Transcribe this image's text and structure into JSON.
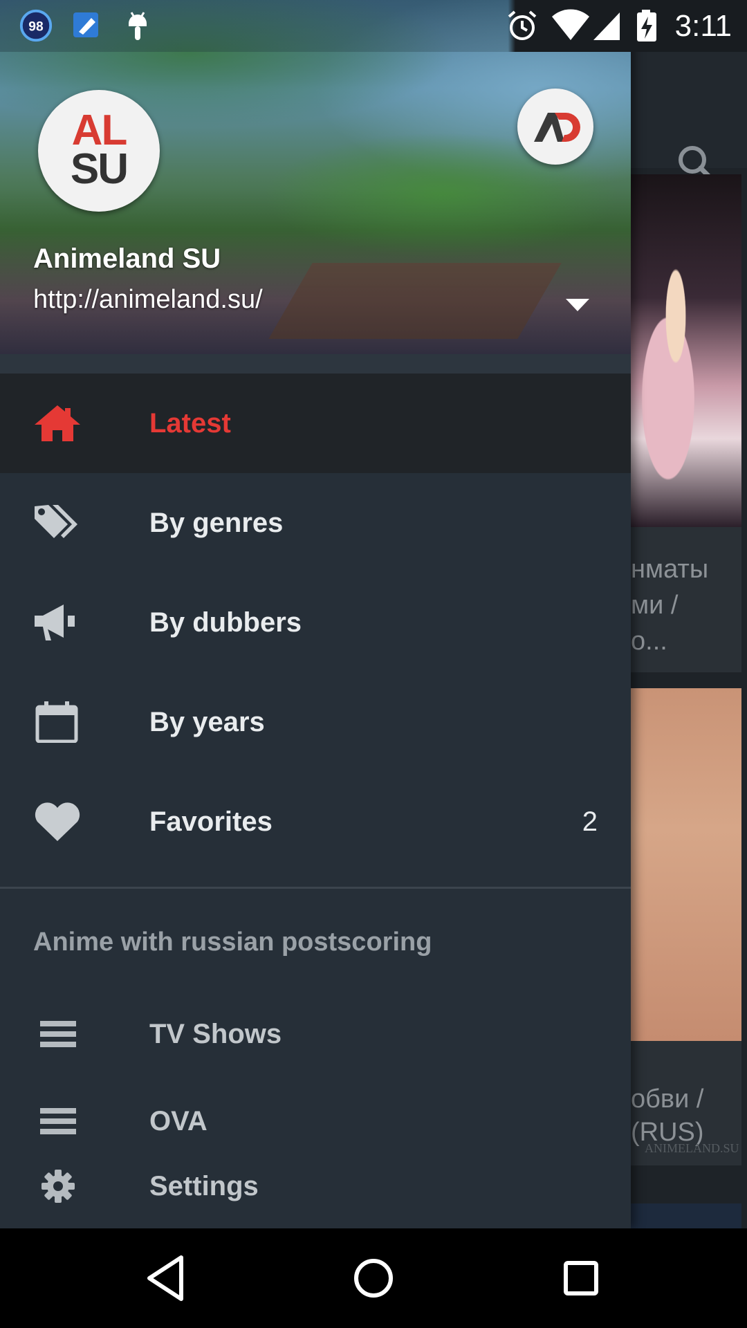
{
  "status_bar": {
    "badge_count": "98",
    "time": "3:11"
  },
  "drawer": {
    "header": {
      "avatar_line1": "AL",
      "avatar_line2": "SU",
      "account_name": "Animeland SU",
      "account_url": "http://animeland.su/"
    },
    "nav": [
      {
        "label": "Latest",
        "icon": "home-icon",
        "active": true
      },
      {
        "label": "By genres",
        "icon": "tags-icon"
      },
      {
        "label": "By dubbers",
        "icon": "megaphone-icon"
      },
      {
        "label": "By years",
        "icon": "calendar-icon"
      },
      {
        "label": "Favorites",
        "icon": "heart-icon",
        "count": "2"
      }
    ],
    "section_title": "Anime with russian postscoring",
    "sub_items": [
      {
        "label": "TV Shows",
        "icon": "list-icon"
      },
      {
        "label": "OVA",
        "icon": "list-icon"
      },
      {
        "label": "Settings",
        "icon": "gear-icon"
      }
    ]
  },
  "background": {
    "card1_title": "нматы\nми /\nо...",
    "card2_title": "обви /\n(RUS)",
    "card2_watermark": "ANIMELAND.SU"
  },
  "colors": {
    "accent": "#e53935",
    "drawer_bg": "#262f38",
    "active_row_bg": "#202428"
  }
}
